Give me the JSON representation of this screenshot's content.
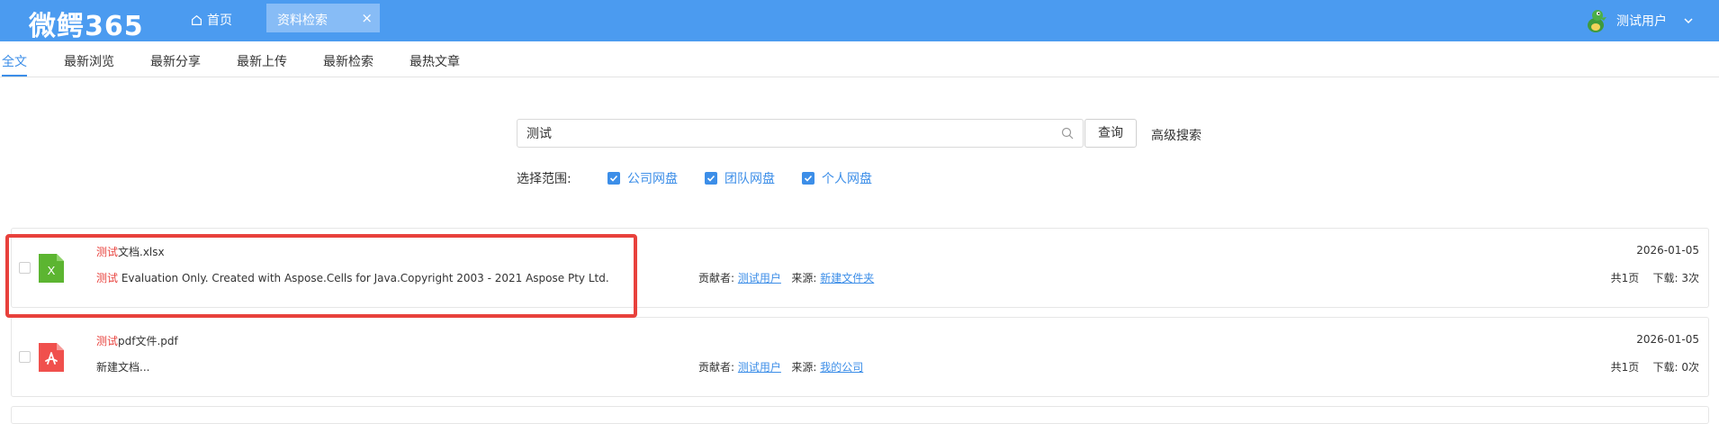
{
  "header": {
    "logo": "微鳄365",
    "home_label": "首页",
    "tab_label": "资料检索",
    "tab_close": "×",
    "user_name": "测试用户"
  },
  "subnav": {
    "items": [
      "全文",
      "最新浏览",
      "最新分享",
      "最新上传",
      "最新检索",
      "最热文章"
    ],
    "active": 0
  },
  "search": {
    "value": "测试",
    "button_label": "查询",
    "advanced_label": "高级搜索"
  },
  "scope": {
    "label": "选择范围:",
    "options": [
      {
        "label": "公司网盘",
        "checked": true
      },
      {
        "label": "团队网盘",
        "checked": true
      },
      {
        "label": "个人网盘",
        "checked": true
      }
    ]
  },
  "results": [
    {
      "file_type": "excel",
      "icon_letter": "X",
      "title_highlight": "测试",
      "title_rest": "文档.xlsx",
      "desc_highlight": "测试",
      "desc_rest": " Evaluation Only. Created with Aspose.Cells for Java.Copyright 2003 - 2021 Aspose Pty Ltd.",
      "contributor_label": "贡献者:",
      "contributor": "测试用户",
      "source_label": "来源:",
      "source": "新建文件夹",
      "date": "2026-01-05",
      "pages": "共1页",
      "downloads": "下载: 3次"
    },
    {
      "file_type": "pdf",
      "icon_letter": "",
      "title_highlight": "测试",
      "title_rest": "pdf文件.pdf",
      "desc_highlight": "",
      "desc_rest": "新建文档...",
      "contributor_label": "贡献者:",
      "contributor": "测试用户",
      "source_label": "来源:",
      "source": "我的公司",
      "date": "2026-01-05",
      "pages": "共1页",
      "downloads": "下载: 0次"
    }
  ],
  "colors": {
    "topbar": "#4b9bf0",
    "accent": "#3c8ee8",
    "highlight": "#e8413c",
    "excel_green": "#5cb531",
    "pdf_red": "#f0504d"
  }
}
